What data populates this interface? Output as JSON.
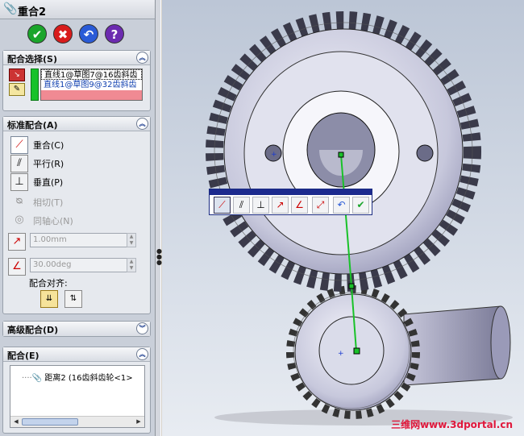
{
  "panel": {
    "title": "重合2",
    "actions": [
      {
        "name": "ok",
        "symbol": "✔",
        "color": "#1aa52b"
      },
      {
        "name": "cancel",
        "symbol": "✖",
        "color": "#d81c1c"
      },
      {
        "name": "undo",
        "symbol": "↶",
        "color": "#2a5bd7"
      },
      {
        "name": "help",
        "symbol": "?",
        "color": "#6c2bb0"
      }
    ],
    "selection": {
      "header": "配合选择(S)",
      "items": [
        "直线1@草图7@16齿斜齿",
        "直线1@草图9@32齿斜齿"
      ]
    },
    "standard": {
      "header": "标准配合(A)",
      "options": [
        "重合(C)",
        "平行(R)",
        "垂直(P)",
        "相切(T)",
        "同轴心(N)"
      ],
      "distance_value": "1.00mm",
      "angle_value": "30.00deg",
      "alignment_label": "配合对齐:"
    },
    "advanced": {
      "header": "高级配合(D)"
    },
    "mates": {
      "header": "配合(E)",
      "items": [
        "距离2 (16齿斜齿轮<1>"
      ]
    }
  },
  "viewport": {
    "watermark": "三维网www.3dportal.cn"
  },
  "colors": {
    "selection_green": "#17c22a",
    "selection_red": "#f08a93",
    "accent": "#1c2a8e"
  }
}
